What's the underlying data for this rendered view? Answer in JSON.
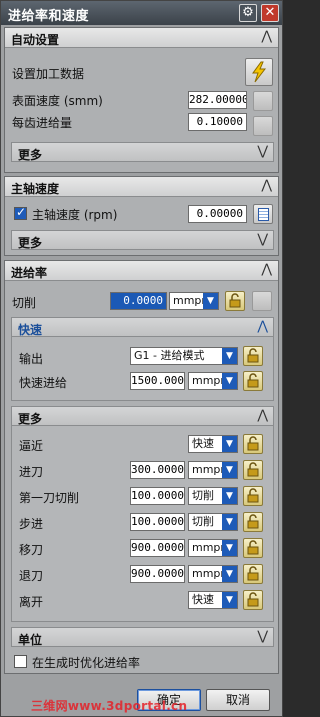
{
  "title": "进给率和速度",
  "auto": {
    "header": "自动设置",
    "set_data_label": "设置加工数据",
    "surface_speed_label": "表面速度 (smm)",
    "surface_speed_value": "282.00000",
    "feed_per_tooth_label": "每齿进给量",
    "feed_per_tooth_value": "0.10000",
    "more": "更多"
  },
  "spindle": {
    "header": "主轴速度",
    "checkbox_label": "主轴速度 (rpm)",
    "value": "0.00000",
    "more": "更多"
  },
  "feed": {
    "header": "进给率",
    "cut_label": "切削",
    "cut_value": "0.0000",
    "cut_unit": "mmpm",
    "rapid": {
      "header": "快速",
      "output_label": "输出",
      "output_value": "G1 - 进给模式",
      "rapid_feed_label": "快速进给",
      "rapid_feed_value": "1500.0000",
      "rapid_feed_unit": "mmpm"
    },
    "more": {
      "header": "更多",
      "rows": [
        {
          "label": "逼近",
          "value": "",
          "unit": "快速"
        },
        {
          "label": "进刀",
          "value": "300.00000",
          "unit": "mmpm"
        },
        {
          "label": "第一刀切削",
          "value": "100.00000",
          "unit": "切削"
        },
        {
          "label": "步进",
          "value": "100.00000",
          "unit": "切削"
        },
        {
          "label": "移刀",
          "value": "900.00000",
          "unit": "mmpm"
        },
        {
          "label": "退刀",
          "value": "900.00000",
          "unit": "mmpm"
        },
        {
          "label": "离开",
          "value": "",
          "unit": "快速"
        }
      ]
    },
    "units_header": "单位",
    "optimize_label": "在生成时优化进给率"
  },
  "footer": {
    "ok": "确定",
    "cancel": "取消",
    "watermark": "三维网www.3dportal.cn"
  },
  "colors": {
    "accent": "#1e5bb8",
    "title_bar": "#3b4249",
    "close": "#c0392b"
  }
}
